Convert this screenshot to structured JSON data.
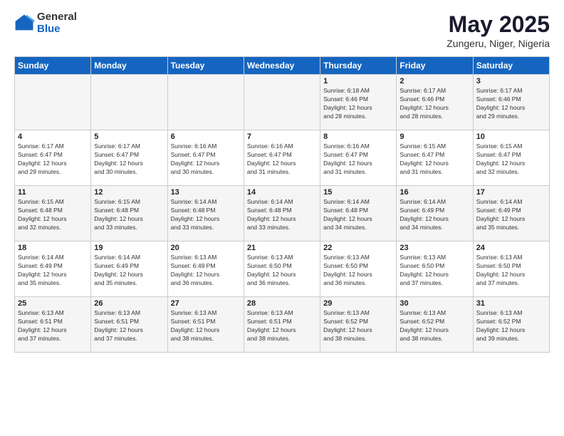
{
  "logo": {
    "general": "General",
    "blue": "Blue"
  },
  "header": {
    "title": "May 2025",
    "subtitle": "Zungeru, Niger, Nigeria"
  },
  "columns": [
    "Sunday",
    "Monday",
    "Tuesday",
    "Wednesday",
    "Thursday",
    "Friday",
    "Saturday"
  ],
  "weeks": [
    [
      {
        "day": "",
        "info": ""
      },
      {
        "day": "",
        "info": ""
      },
      {
        "day": "",
        "info": ""
      },
      {
        "day": "",
        "info": ""
      },
      {
        "day": "1",
        "info": "Sunrise: 6:18 AM\nSunset: 6:46 PM\nDaylight: 12 hours\nand 28 minutes."
      },
      {
        "day": "2",
        "info": "Sunrise: 6:17 AM\nSunset: 6:46 PM\nDaylight: 12 hours\nand 28 minutes."
      },
      {
        "day": "3",
        "info": "Sunrise: 6:17 AM\nSunset: 6:46 PM\nDaylight: 12 hours\nand 29 minutes."
      }
    ],
    [
      {
        "day": "4",
        "info": "Sunrise: 6:17 AM\nSunset: 6:47 PM\nDaylight: 12 hours\nand 29 minutes."
      },
      {
        "day": "5",
        "info": "Sunrise: 6:17 AM\nSunset: 6:47 PM\nDaylight: 12 hours\nand 30 minutes."
      },
      {
        "day": "6",
        "info": "Sunrise: 6:16 AM\nSunset: 6:47 PM\nDaylight: 12 hours\nand 30 minutes."
      },
      {
        "day": "7",
        "info": "Sunrise: 6:16 AM\nSunset: 6:47 PM\nDaylight: 12 hours\nand 31 minutes."
      },
      {
        "day": "8",
        "info": "Sunrise: 6:16 AM\nSunset: 6:47 PM\nDaylight: 12 hours\nand 31 minutes."
      },
      {
        "day": "9",
        "info": "Sunrise: 6:15 AM\nSunset: 6:47 PM\nDaylight: 12 hours\nand 31 minutes."
      },
      {
        "day": "10",
        "info": "Sunrise: 6:15 AM\nSunset: 6:47 PM\nDaylight: 12 hours\nand 32 minutes."
      }
    ],
    [
      {
        "day": "11",
        "info": "Sunrise: 6:15 AM\nSunset: 6:48 PM\nDaylight: 12 hours\nand 32 minutes."
      },
      {
        "day": "12",
        "info": "Sunrise: 6:15 AM\nSunset: 6:48 PM\nDaylight: 12 hours\nand 33 minutes."
      },
      {
        "day": "13",
        "info": "Sunrise: 6:14 AM\nSunset: 6:48 PM\nDaylight: 12 hours\nand 33 minutes."
      },
      {
        "day": "14",
        "info": "Sunrise: 6:14 AM\nSunset: 6:48 PM\nDaylight: 12 hours\nand 33 minutes."
      },
      {
        "day": "15",
        "info": "Sunrise: 6:14 AM\nSunset: 6:48 PM\nDaylight: 12 hours\nand 34 minutes."
      },
      {
        "day": "16",
        "info": "Sunrise: 6:14 AM\nSunset: 6:49 PM\nDaylight: 12 hours\nand 34 minutes."
      },
      {
        "day": "17",
        "info": "Sunrise: 6:14 AM\nSunset: 6:49 PM\nDaylight: 12 hours\nand 35 minutes."
      }
    ],
    [
      {
        "day": "18",
        "info": "Sunrise: 6:14 AM\nSunset: 6:49 PM\nDaylight: 12 hours\nand 35 minutes."
      },
      {
        "day": "19",
        "info": "Sunrise: 6:14 AM\nSunset: 6:49 PM\nDaylight: 12 hours\nand 35 minutes."
      },
      {
        "day": "20",
        "info": "Sunrise: 6:13 AM\nSunset: 6:49 PM\nDaylight: 12 hours\nand 36 minutes."
      },
      {
        "day": "21",
        "info": "Sunrise: 6:13 AM\nSunset: 6:50 PM\nDaylight: 12 hours\nand 36 minutes."
      },
      {
        "day": "22",
        "info": "Sunrise: 6:13 AM\nSunset: 6:50 PM\nDaylight: 12 hours\nand 36 minutes."
      },
      {
        "day": "23",
        "info": "Sunrise: 6:13 AM\nSunset: 6:50 PM\nDaylight: 12 hours\nand 37 minutes."
      },
      {
        "day": "24",
        "info": "Sunrise: 6:13 AM\nSunset: 6:50 PM\nDaylight: 12 hours\nand 37 minutes."
      }
    ],
    [
      {
        "day": "25",
        "info": "Sunrise: 6:13 AM\nSunset: 6:51 PM\nDaylight: 12 hours\nand 37 minutes."
      },
      {
        "day": "26",
        "info": "Sunrise: 6:13 AM\nSunset: 6:51 PM\nDaylight: 12 hours\nand 37 minutes."
      },
      {
        "day": "27",
        "info": "Sunrise: 6:13 AM\nSunset: 6:51 PM\nDaylight: 12 hours\nand 38 minutes."
      },
      {
        "day": "28",
        "info": "Sunrise: 6:13 AM\nSunset: 6:51 PM\nDaylight: 12 hours\nand 38 minutes."
      },
      {
        "day": "29",
        "info": "Sunrise: 6:13 AM\nSunset: 6:52 PM\nDaylight: 12 hours\nand 38 minutes."
      },
      {
        "day": "30",
        "info": "Sunrise: 6:13 AM\nSunset: 6:52 PM\nDaylight: 12 hours\nand 38 minutes."
      },
      {
        "day": "31",
        "info": "Sunrise: 6:13 AM\nSunset: 6:52 PM\nDaylight: 12 hours\nand 39 minutes."
      }
    ]
  ]
}
